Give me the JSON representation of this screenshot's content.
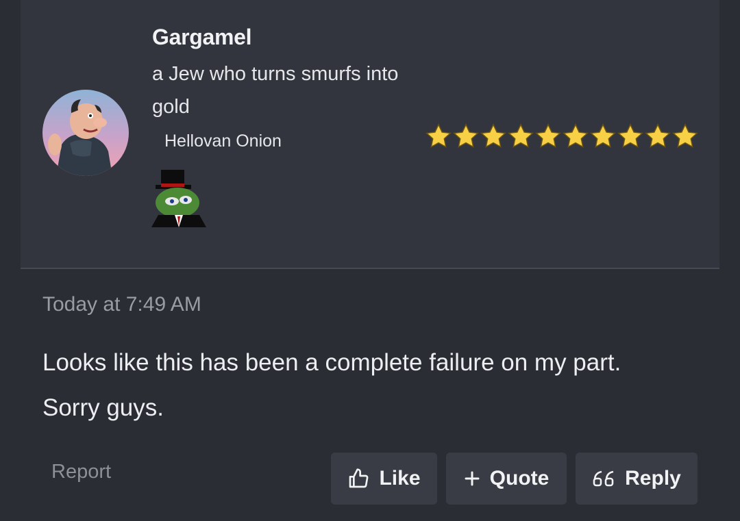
{
  "post": {
    "author": {
      "name": "Gargamel",
      "title": "a Jew who turns smurfs into gold",
      "banner": "Hellovan Onion",
      "rating_stars": 10
    },
    "timestamp": "Today at 7:49 AM",
    "message_lines": [
      "Looks like this has been a complete failure on my part.",
      "Sorry guys."
    ]
  },
  "actions": {
    "report_label": "Report",
    "like_label": "Like",
    "quote_label": "Quote",
    "reply_label": "Reply"
  },
  "colors": {
    "background": "#2b2d35",
    "panel": "#33353e",
    "button": "#3a3c45",
    "star": "#f7d046"
  },
  "icons": {
    "like": "thumbs-up-icon",
    "quote": "plus-icon",
    "reply": "quote-marks-icon"
  }
}
